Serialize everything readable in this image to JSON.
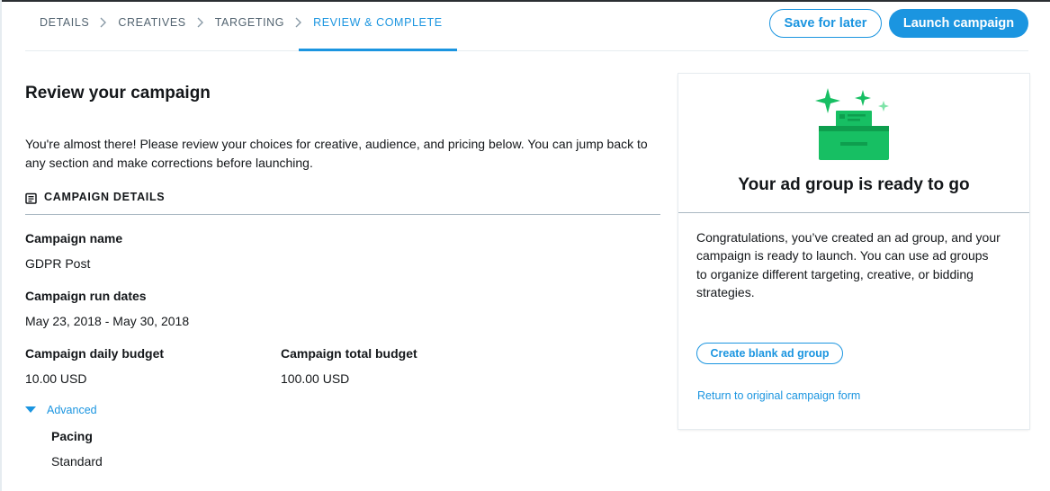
{
  "stepper": {
    "steps": [
      "DETAILS",
      "CREATIVES",
      "TARGETING",
      "REVIEW & COMPLETE"
    ],
    "active_index": 3
  },
  "header": {
    "save_label": "Save for later",
    "launch_label": "Launch campaign"
  },
  "review": {
    "title": "Review your campaign",
    "intro": "You're almost there! Please review your choices for creative, audience, and pricing below. You can jump back to any section and make corrections before launching.",
    "section_heading": "CAMPAIGN DETAILS",
    "campaign_name_label": "Campaign name",
    "campaign_name_value": "GDPR Post",
    "run_dates_label": "Campaign run dates",
    "run_dates_value": "May 23, 2018 - May 30, 2018",
    "daily_budget_label": "Campaign daily budget",
    "daily_budget_value": "10.00 USD",
    "total_budget_label": "Campaign total budget",
    "total_budget_value": "100.00 USD",
    "advanced_label": "Advanced",
    "pacing_label": "Pacing",
    "pacing_value": "Standard"
  },
  "card": {
    "title": "Your ad group is ready to go",
    "body": "Congratulations, you’ve created an ad group, and your campaign is ready to launch. You can use ad groups to organize different targeting, creative, or bidding strategies.",
    "create_button": "Create blank ad group",
    "return_link": "Return to original campaign form"
  },
  "colors": {
    "accent": "#1b95e0",
    "illustration_green": "#17bf63"
  }
}
